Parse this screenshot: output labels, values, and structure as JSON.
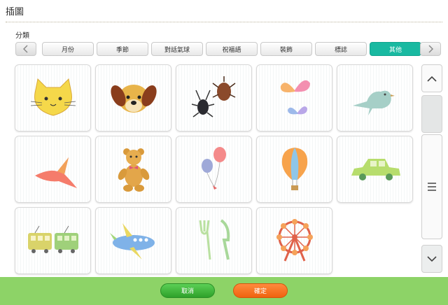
{
  "window": {
    "title": "插圖"
  },
  "category": {
    "label": "分類",
    "prev_icon": "chevron-left-icon",
    "next_icon": "chevron-right-icon",
    "tabs": [
      {
        "label": "月份"
      },
      {
        "label": "季節"
      },
      {
        "label": "對話氣球"
      },
      {
        "label": "祝福語"
      },
      {
        "label": "裝飾"
      },
      {
        "label": "標誌"
      },
      {
        "label": "其他",
        "active": true
      }
    ],
    "active_color": "#19b9a1"
  },
  "gallery": {
    "items": [
      {
        "icon": "cat-icon"
      },
      {
        "icon": "dog-icon"
      },
      {
        "icon": "beetles-icon"
      },
      {
        "icon": "butterflies-icon"
      },
      {
        "icon": "bird-icon"
      },
      {
        "icon": "flying-bird-icon"
      },
      {
        "icon": "teddy-bear-icon"
      },
      {
        "icon": "balloons-icon"
      },
      {
        "icon": "hot-air-balloon-icon"
      },
      {
        "icon": "car-icon"
      },
      {
        "icon": "train-icon"
      },
      {
        "icon": "airplane-icon"
      },
      {
        "icon": "fork-knife-icon"
      },
      {
        "icon": "ferris-wheel-icon"
      }
    ]
  },
  "scrollbar": {
    "up_icon": "chevron-up-icon",
    "menu_icon": "menu-icon",
    "down_icon": "chevron-down-icon"
  },
  "footer": {
    "cancel_label": "取消",
    "confirm_label": "確定",
    "bar_color": "#8dd367",
    "cancel_color": "#3cb636",
    "confirm_color": "#f5701c"
  }
}
